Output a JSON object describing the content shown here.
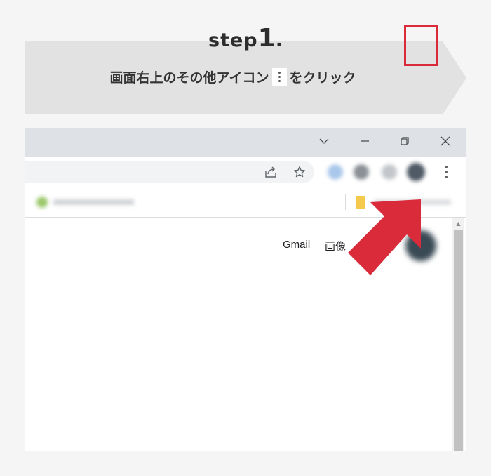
{
  "header": {
    "step_word": "step",
    "step_number": "1",
    "step_dot": "."
  },
  "instruction": {
    "before": "画面右上のその他アイコン",
    "after": "をクリック"
  },
  "browser": {
    "titlebar": {
      "tab_search_icon": "chevron-down",
      "minimize_icon": "minimize",
      "restore_icon": "restore",
      "close_icon": "close"
    },
    "toolbar": {
      "share_icon": "share",
      "bookmark_star_icon": "star",
      "menu_icon": "three-dots-vertical"
    },
    "content": {
      "links": [
        "Gmail",
        "画像"
      ]
    }
  },
  "colors": {
    "highlight": "#d92b3a",
    "banner": "#e3e2e2",
    "titlebar": "#dee1e6",
    "background": "#f5f5f5"
  }
}
